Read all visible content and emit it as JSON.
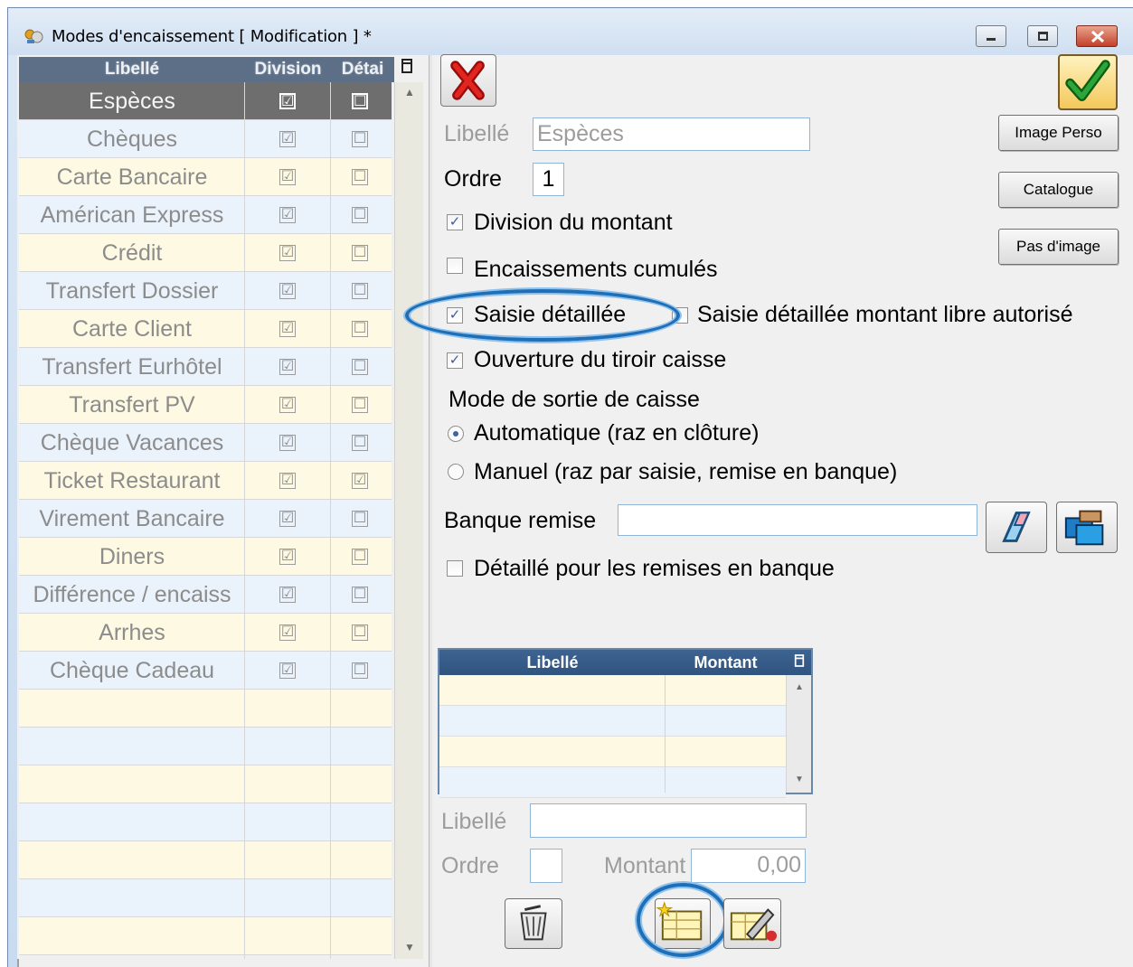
{
  "window": {
    "title": "Modes d'encaissement  [ Modification ] *",
    "buttons": [
      "minimize",
      "restore",
      "close"
    ]
  },
  "list": {
    "headers": [
      "Libellé",
      "Division",
      "Détai"
    ],
    "rows": [
      {
        "label": "Espèces",
        "division": "☑",
        "detail": "☐",
        "selected": true
      },
      {
        "label": "Chèques",
        "division": "☑",
        "detail": "☐"
      },
      {
        "label": "Carte Bancaire",
        "division": "☑",
        "detail": "☐"
      },
      {
        "label": "Américan Express",
        "division": "☑",
        "detail": "☐"
      },
      {
        "label": "Crédit",
        "division": "☑",
        "detail": "☐"
      },
      {
        "label": "Transfert Dossier",
        "division": "☑",
        "detail": "☐"
      },
      {
        "label": "Carte Client",
        "division": "☑",
        "detail": "☐"
      },
      {
        "label": "Transfert Eurhôtel",
        "division": "☑",
        "detail": "☐"
      },
      {
        "label": "Transfert PV",
        "division": "☑",
        "detail": "☐"
      },
      {
        "label": "Chèque Vacances",
        "division": "☑",
        "detail": "☐"
      },
      {
        "label": "Ticket Restaurant",
        "division": "☑",
        "detail": "☑"
      },
      {
        "label": "Virement Bancaire",
        "division": "☑",
        "detail": "☐"
      },
      {
        "label": "Diners",
        "division": "☑",
        "detail": "☐"
      },
      {
        "label": "Différence / encaiss",
        "division": "☑",
        "detail": "☐"
      },
      {
        "label": "Arrhes",
        "division": "☑",
        "detail": "☐"
      },
      {
        "label": "Chèque Cadeau",
        "division": "☑",
        "detail": "☐"
      }
    ]
  },
  "form": {
    "libelle_label": "Libellé",
    "libelle_value": "Espèces",
    "ordre_label": "Ordre",
    "ordre_value": "1",
    "division_label": "Division du montant",
    "division_checked": true,
    "cumules_label": "Encaissements cumulés",
    "cumules_checked": false,
    "saisie_label": "Saisie détaillée",
    "saisie_checked": true,
    "libre_label": "Saisie détaillée montant libre autorisé",
    "libre_checked": false,
    "tiroir_label": "Ouverture du tiroir caisse",
    "tiroir_checked": true,
    "mode_title": "Mode de sortie de caisse",
    "mode_auto": "Automatique (raz en clôture)",
    "mode_manuel": "Manuel (raz par saisie, remise en banque)",
    "mode_selected": "auto",
    "banque_label": "Banque remise",
    "banque_value": "",
    "remises_label": "Détaillé pour les remises en banque",
    "remises_checked": false
  },
  "buttons": {
    "image_perso": "Image Perso",
    "catalogue": "Catalogue",
    "pas_image": "Pas d'image"
  },
  "sub_table": {
    "headers": [
      "Libellé",
      "Montant"
    ],
    "rows": 4
  },
  "sub_form": {
    "libelle_label": "Libellé",
    "libelle_value": "",
    "ordre_label": "Ordre",
    "ordre_value": "",
    "montant_label": "Montant",
    "montant_value": "0,00"
  },
  "colors": {
    "highlight": "#1e6fb8",
    "selected_row": "#6e6e6e",
    "row_odd": "#fdf9e2",
    "row_even": "#eaf2fb"
  }
}
